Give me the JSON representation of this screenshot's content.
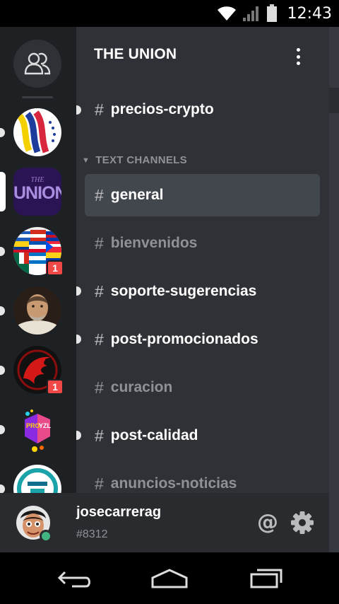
{
  "status_bar": {
    "time": "12:43",
    "icons": [
      "wifi-icon",
      "signal-icon",
      "battery-icon"
    ]
  },
  "guild_rail": {
    "dm_icon": "friends-icon",
    "guilds": [
      {
        "name": "venezuela-flag-guild",
        "unread": true,
        "badge": ""
      },
      {
        "name": "the-union-guild",
        "selected": true,
        "badge": "",
        "logo_text_top": "THE",
        "logo_text": "UNION"
      },
      {
        "name": "latam-flags-guild",
        "unread": true,
        "badge": "1"
      },
      {
        "name": "portrait-guild",
        "unread": true,
        "badge": ""
      },
      {
        "name": "red-phoenix-guild",
        "unread": true,
        "badge": "1"
      },
      {
        "name": "proyzl-guild",
        "unread": true,
        "badge": "",
        "logo_text_top": "PRO",
        "logo_text": "YZL"
      },
      {
        "name": "teal-logo-guild",
        "unread": true,
        "badge": ""
      }
    ]
  },
  "channel_panel": {
    "guild_name": "THE UNION",
    "menu_icon": "kebab-menu-icon",
    "hash": "#",
    "top_channel": {
      "name": "precios-crypto",
      "unread": true
    },
    "category": {
      "label": "TEXT CHANNELS",
      "icon": "chevron-down-icon"
    },
    "channels": [
      {
        "name": "general",
        "selected": true,
        "unread": false
      },
      {
        "name": "bienvenidos",
        "selected": false,
        "unread": false
      },
      {
        "name": "soporte-sugerencias",
        "selected": false,
        "unread": true
      },
      {
        "name": "post-promocionados",
        "selected": false,
        "unread": true
      },
      {
        "name": "curacion",
        "selected": false,
        "unread": false
      },
      {
        "name": "post-calidad",
        "selected": false,
        "unread": true
      },
      {
        "name": "anuncios-noticias",
        "selected": false,
        "unread": false
      }
    ]
  },
  "user_bar": {
    "username": "josecarrerag",
    "discriminator": "#8312",
    "status": "online",
    "mention_label": "@",
    "settings_icon": "gear-icon"
  },
  "nav_bar": {
    "buttons": [
      "back-icon",
      "home-icon",
      "recents-icon"
    ]
  },
  "colors": {
    "rail": "#1e2124",
    "panel": "#2f3136",
    "selected_channel": "#42464d",
    "userbar": "#292b2f",
    "badge": "#f04747",
    "online": "#43b581"
  }
}
